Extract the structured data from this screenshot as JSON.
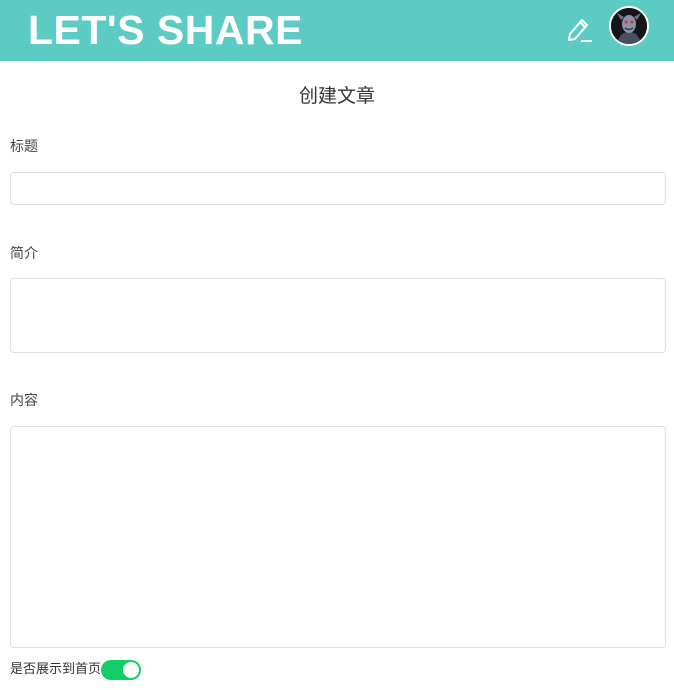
{
  "header": {
    "logo_text": "LET'S SHARE",
    "background_color": "#5bcbc4",
    "edit_icon": "pencil-icon",
    "avatar": "user-avatar"
  },
  "page": {
    "title": "创建文章"
  },
  "form": {
    "title_label": "标题",
    "title_value": "",
    "summary_label": "简介",
    "summary_value": "",
    "content_label": "内容",
    "content_value": "",
    "show_on_home_label": "是否展示到首页",
    "show_on_home": true,
    "switch_on_color": "#13ce66"
  }
}
